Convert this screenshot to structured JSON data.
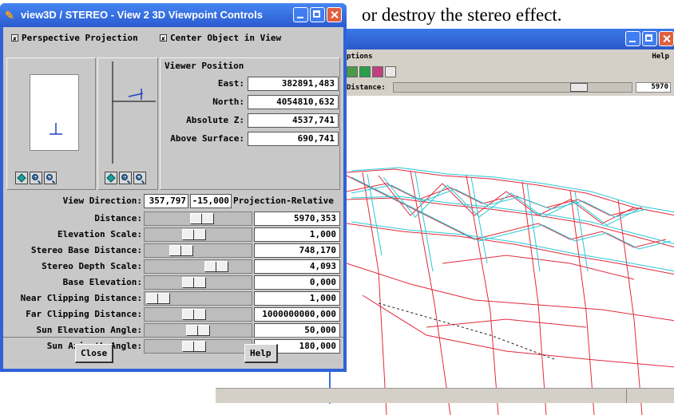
{
  "caption": "or destroy the stereo effect.",
  "background_window": {
    "menu_left": "ptions",
    "menu_right": "Help",
    "distance_label": "Distance:",
    "distance_value": "5970",
    "distance_slider_level": 0.8,
    "dropdown_value": "5"
  },
  "dialog": {
    "title": "view3D / STEREO - View 2 3D Viewpoint Controls",
    "perspective_label": "Perspective Projection",
    "center_label": "Center Object in View",
    "viewer_position": {
      "title": "Viewer Position",
      "rows": [
        {
          "label": "East:",
          "value": "382891,483"
        },
        {
          "label": "North:",
          "value": "4054810,632"
        },
        {
          "label": "Absolute Z:",
          "value": "4537,741"
        },
        {
          "label": "Above Surface:",
          "value": "690,741"
        }
      ]
    },
    "view_direction": {
      "label": "View Direction:",
      "azimuth": "357,797",
      "elevation": "-15,000",
      "mode": "Projection-Relative"
    },
    "sliders": [
      {
        "label": "Distance:",
        "value": "5970,353",
        "level": 0.55
      },
      {
        "label": "Elevation Scale:",
        "value": "1,000",
        "level": 0.45
      },
      {
        "label": "Stereo Base Distance:",
        "value": "748,170",
        "level": 0.3
      },
      {
        "label": "Stereo Depth Scale:",
        "value": "4,093",
        "level": 0.72
      },
      {
        "label": "Base Elevation:",
        "value": "0,000",
        "level": 0.45
      },
      {
        "label": "Near Clipping Distance:",
        "value": "1,000",
        "level": 0.02
      },
      {
        "label": "Far Clipping Distance:",
        "value": "1000000000,000",
        "level": 0.45
      },
      {
        "label": "Sun Elevation Angle:",
        "value": "50,000",
        "level": 0.5
      },
      {
        "label": "Sun Azimuth Angle:",
        "value": "180,000",
        "level": 0.45
      }
    ],
    "close_label": "Close",
    "help_label": "Help"
  }
}
